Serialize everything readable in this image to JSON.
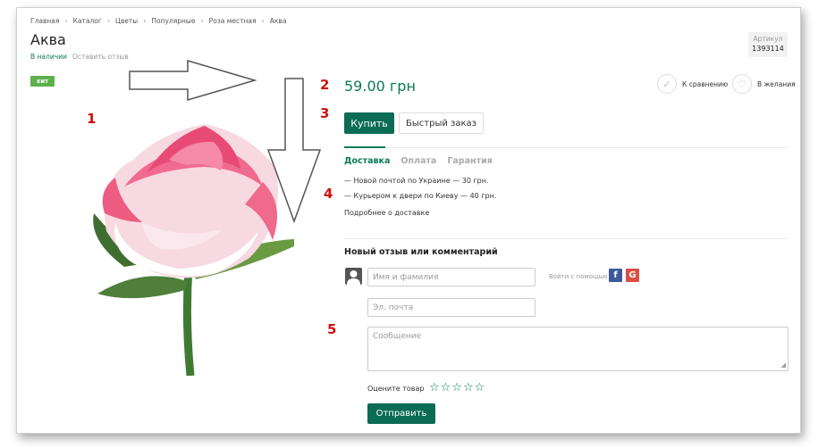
{
  "breadcrumb": [
    "Главная",
    "Каталог",
    "Цветы",
    "Популярные",
    "Роза местная",
    "Аква"
  ],
  "product": {
    "title": "Аква",
    "stock": "В наличии",
    "review_link": "Оставить отзыв",
    "sku_label": "Артикул",
    "sku": "1393114",
    "badge": "хит",
    "price": "59.00 грн",
    "compare": "К сравнению",
    "wishlist": "В желания",
    "buy": "Купить",
    "quick_order": "Быстрый заказ"
  },
  "tabs": [
    "Доставка",
    "Оплата",
    "Гарантия"
  ],
  "delivery": {
    "lines": [
      "— Новой почтой по Украине — 30 грн.",
      "— Курьером к двери по Киеву — 40 грн."
    ],
    "more": "Подробнее о доставке"
  },
  "review": {
    "title": "Новый отзыв или комментарий",
    "name_placeholder": "Имя и фамилия",
    "email_placeholder": "Эл. почта",
    "message_placeholder": "Сообщение",
    "login_with": "Войти с помощью",
    "facebook": "f",
    "google": "G",
    "rate_label": "Оцените товар",
    "stars": "☆☆☆☆☆",
    "submit": "Отправить"
  },
  "annotations": [
    "1",
    "2",
    "3",
    "4",
    "5"
  ],
  "colors": {
    "accent": "#0a7a58",
    "button": "#0b6b55",
    "badge": "#5db14a",
    "annotation": "#d01010"
  }
}
